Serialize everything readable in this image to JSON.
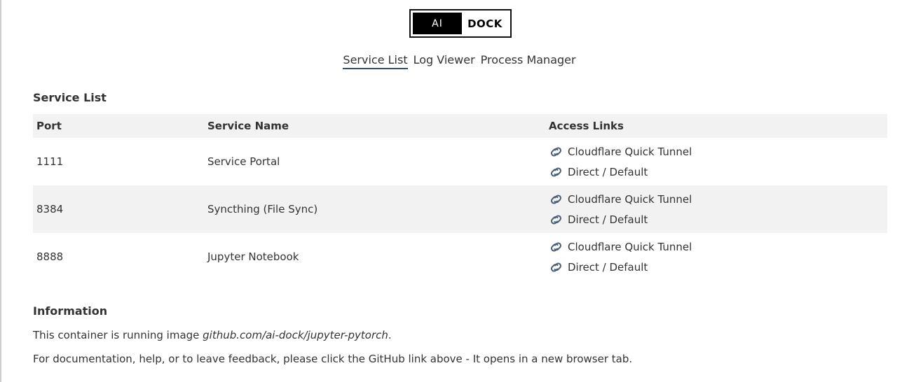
{
  "logo": {
    "left": "AI",
    "right": "DOCK"
  },
  "nav": {
    "items": [
      {
        "label": "Service List",
        "active": true
      },
      {
        "label": "Log Viewer",
        "active": false
      },
      {
        "label": "Process Manager",
        "active": false
      }
    ]
  },
  "services": {
    "heading": "Service List",
    "columns": [
      "Port",
      "Service Name",
      "Access Links"
    ],
    "rows": [
      {
        "port": "1111",
        "name": "Service Portal",
        "links": [
          "Cloudflare Quick Tunnel",
          "Direct / Default"
        ]
      },
      {
        "port": "8384",
        "name": "Syncthing (File Sync)",
        "links": [
          "Cloudflare Quick Tunnel",
          "Direct / Default"
        ]
      },
      {
        "port": "8888",
        "name": "Jupyter Notebook",
        "links": [
          "Cloudflare Quick Tunnel",
          "Direct / Default"
        ]
      }
    ]
  },
  "info": {
    "heading": "Information",
    "line1_prefix": "This container is running image ",
    "line1_image": "github.com/ai-dock/jupyter-pytorch",
    "line1_suffix": ".",
    "line2": "For documentation, help, or to leave feedback, please click the GitHub link above - It opens in a new browser tab."
  },
  "colors": {
    "link_icon": "#4a5f78",
    "active_underline": "#2f4f6e",
    "row_shade": "#f2f2f2"
  },
  "icons": {
    "access_link": "link-icon"
  }
}
